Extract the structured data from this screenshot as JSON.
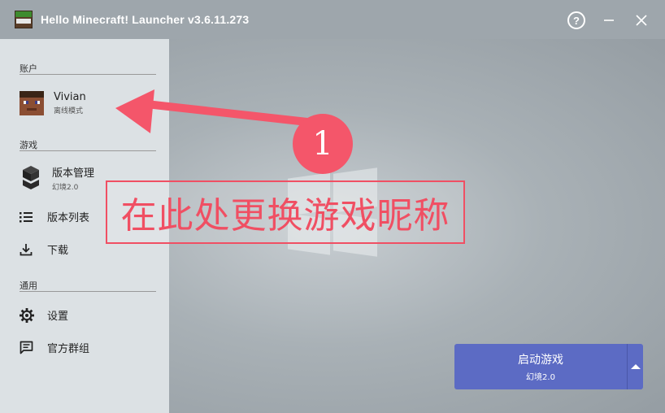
{
  "window": {
    "title": "Hello Minecraft! Launcher v3.6.11.273",
    "help_label": "?"
  },
  "sidebar": {
    "accounts_title": "账户",
    "account": {
      "name": "Vivian",
      "mode": "离线模式"
    },
    "game_title": "游戏",
    "version_manage": {
      "label": "版本管理",
      "sub": "幻境2.0"
    },
    "version_list_label": "版本列表",
    "download_label": "下载",
    "general_title": "通用",
    "settings_label": "设置",
    "group_label": "官方群组"
  },
  "annotation": {
    "badge_number": "1",
    "note_text": "在此处更换游戏昵称",
    "color": "#f04f63"
  },
  "launch": {
    "label": "启动游戏",
    "version": "幻境2.0",
    "color": "#5c6bc4"
  },
  "icons": {
    "app": "hmcl-grass-block-icon",
    "help": "help-circle-icon",
    "minimize": "minimize-icon",
    "close": "close-icon",
    "version_manage": "block-stack-icon",
    "version_list": "list-icon",
    "download": "download-icon",
    "settings": "gear-icon",
    "group": "chat-icon",
    "launch_menu": "caret-up-icon"
  }
}
